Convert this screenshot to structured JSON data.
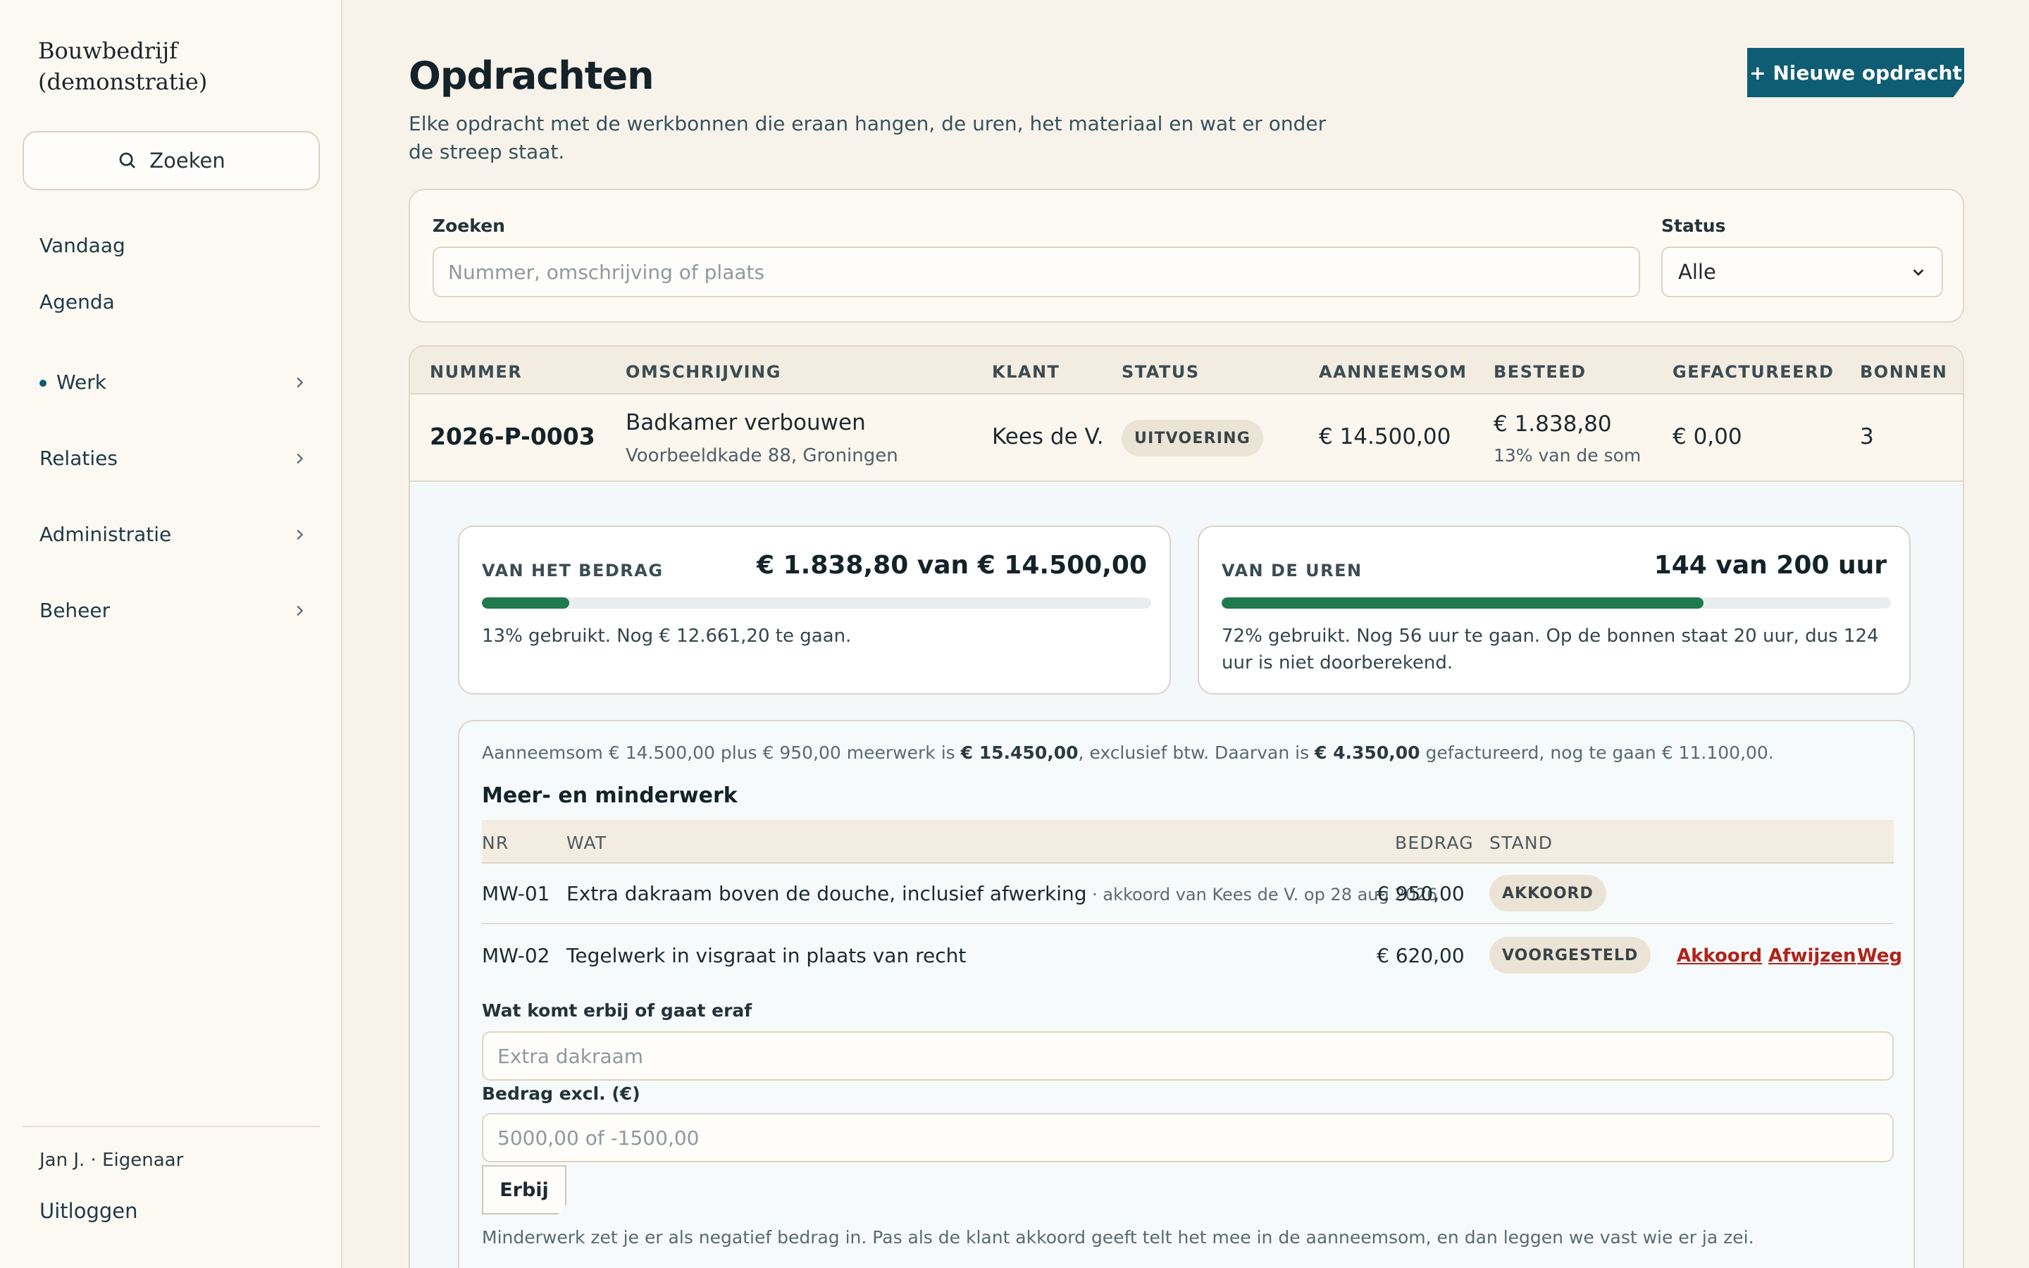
{
  "sidebar": {
    "brand": "Bouwbedrijf (demonstratie)",
    "search_label": "Zoeken",
    "items": [
      {
        "label": "Vandaag"
      },
      {
        "label": "Agenda"
      },
      {
        "label": "Werk"
      },
      {
        "label": "Relaties"
      },
      {
        "label": "Administratie"
      },
      {
        "label": "Beheer"
      }
    ],
    "user": "Jan J. · Eigenaar",
    "logout": "Uitloggen"
  },
  "page": {
    "title": "Opdrachten",
    "subtitle": "Elke opdracht met de werkbonnen die eraan hangen, de uren, het materiaal en wat er onder de streep staat.",
    "new_button": "+ Nieuwe opdracht"
  },
  "filter": {
    "search_label": "Zoeken",
    "search_placeholder": "Nummer, omschrijving of plaats",
    "status_label": "Status",
    "status_value": "Alle"
  },
  "table": {
    "headers": [
      "NUMMER",
      "OMSCHRIJVING",
      "KLANT",
      "STATUS",
      "AANNEEMSOM",
      "BESTEED",
      "GEFACTUREERD",
      "BONNEN"
    ],
    "row": {
      "nummer": "2026-P-0003",
      "omschrijving": "Badkamer verbouwen",
      "adres": "Voorbeeldkade 88, Groningen",
      "klant": "Kees de V.",
      "status": "UITVOERING",
      "aanneemsom": "€ 14.500,00",
      "besteed": "€ 1.838,80",
      "besteed_pct": "13% van de som",
      "gefactureerd": "€ 0,00",
      "bonnen": "3"
    }
  },
  "budget": {
    "bedrag": {
      "label": "VAN HET BEDRAG",
      "value": "€ 1.838,80 van € 14.500,00",
      "progress": 0.13,
      "text": "13% gebruikt. Nog € 12.661,20 te gaan."
    },
    "uren": {
      "label": "VAN DE UREN",
      "value": "144 van 200 uur",
      "progress": 0.72,
      "text": "72% gebruikt. Nog 56 uur te gaan. Op de bonnen staat 20 uur, dus 124 uur is niet doorberekend."
    },
    "colors": {
      "fill": "#1f7a4d",
      "track": "#e9edee"
    }
  },
  "meerwerk": {
    "summary_1": "Aanneemsom € 14.500,00 plus € 950,00 meerwerk is ",
    "summary_total": "€ 15.450,00",
    "summary_2": ", exclusief btw. Daarvan is ",
    "summary_fact": "€ 4.350,00",
    "summary_3": " gefactureerd, nog te gaan € 11.100,00.",
    "title": "Meer- en minderwerk",
    "headers": {
      "nr": "NR",
      "wat": "WAT",
      "bedrag": "BEDRAG",
      "stand": "STAND"
    },
    "rows": [
      {
        "nr": "MW-01",
        "wat": "Extra dakraam boven de douche, inclusief afwerking",
        "note": " · akkoord van Kees de V. op 28 aug 2026",
        "bedrag": "€ 950,00",
        "stand": "AKKOORD"
      },
      {
        "nr": "MW-02",
        "wat": "Tegelwerk in visgraat in plaats van recht",
        "note": "",
        "bedrag": "€ 620,00",
        "stand": "VOORGESTELD"
      }
    ],
    "actions": {
      "accept": "Akkoord",
      "reject": "Afwijzen",
      "remove": "Weg"
    },
    "form": {
      "what_label": "Wat komt erbij of gaat eraf",
      "what_placeholder": "Extra dakraam",
      "amount_label": "Bedrag excl. (€)",
      "amount_placeholder": "5000,00 of -1500,00",
      "submit": "Erbij",
      "help": "Minderwerk zet je er als negatief bedrag in. Pas als de klant akkoord geeft telt het mee in de aanneemsom, en dan leggen we vast wie er ja zei."
    }
  },
  "colors": {
    "accent": "#0e5d74",
    "danger": "#b0231a",
    "background": "#f8f3ea"
  },
  "icons": {
    "search": "search-icon",
    "chevron": "chevron-right-icon"
  }
}
